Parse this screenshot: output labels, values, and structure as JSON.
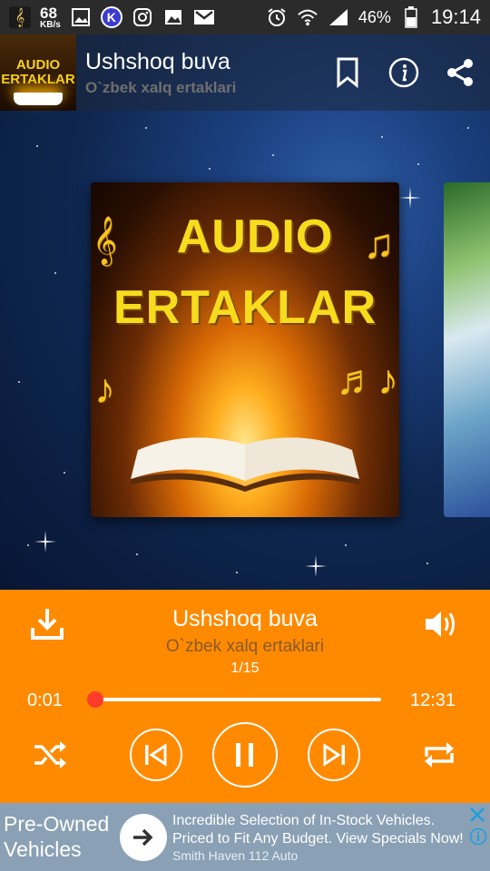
{
  "status_bar": {
    "net_speed_value": "68",
    "net_speed_unit": "KB/s",
    "battery": "46%",
    "time": "19:14",
    "k_badge": "K",
    "icons": [
      "app-icon",
      "gallery-icon",
      "k-icon",
      "instagram-icon",
      "gallery2-icon",
      "gmail-icon",
      "alarm-icon",
      "wifi-icon",
      "signal-icon",
      "battery-icon"
    ]
  },
  "cover_thumb": {
    "line1": "AUDIO",
    "line2": "ERTAKLAR"
  },
  "toolbar": {
    "title": "Ushshoq buva",
    "subtitle": "O`zbek xalq ertaklari",
    "actions": [
      "bookmark-icon",
      "info-icon",
      "share-icon"
    ]
  },
  "cover": {
    "line1": "AUDIO",
    "line2": "ERTAKLAR"
  },
  "player": {
    "title": "Ushshoq buva",
    "subtitle": "O`zbek xalq ertaklari",
    "track_position": "1/15",
    "elapsed": "0:01",
    "duration": "12:31",
    "progress_fraction": 0.0013,
    "is_playing": true,
    "accent_color": "#ff8a00",
    "seek_color": "#ff3b2b"
  },
  "ad": {
    "brand": "Pre-Owned Vehicles",
    "line1": "Incredible Selection of In-Stock Vehicles.",
    "line2": "Priced to Fit Any Budget. View Specials Now!",
    "source": "Smith Haven 112 Auto"
  }
}
